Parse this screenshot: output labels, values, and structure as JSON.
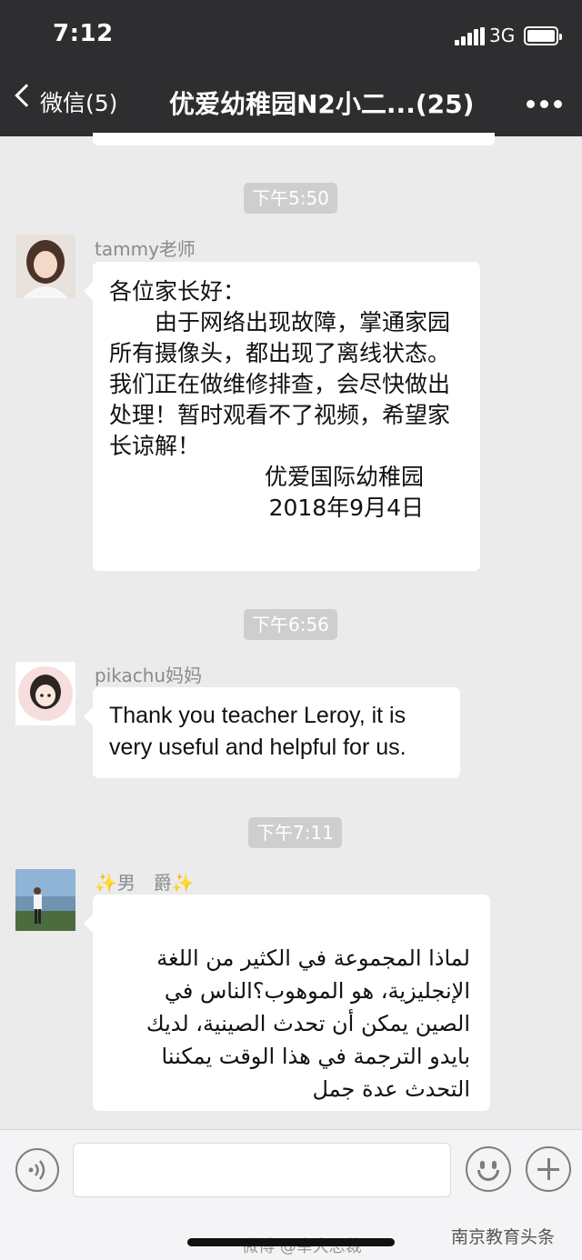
{
  "status_bar": {
    "time": "7:12",
    "network": "3G"
  },
  "nav": {
    "back_label": "微信(5)",
    "title": "优爱幼稚园N2小二...(25)"
  },
  "messages": [
    {
      "time": "下午5:50",
      "sender": "tammy老师",
      "lines": [
        "各位家长好：",
        "由于网络出现故障，掌通家园所有摄像头，都出现了离线状态。我们正在做维修排查，会尽快做出处理！暂时观看不了视频，希望家长谅解！",
        "优爱国际幼稚园",
        "2018年9月4日"
      ]
    },
    {
      "time": "下午6:56",
      "sender": "pikachu妈妈",
      "text": "Thank you teacher Leroy, it is very useful and helpful for us."
    },
    {
      "time": "下午7:11",
      "sender": "✨男　爵✨",
      "text": "لماذا المجموعة في الكثير من اللغة الإنجليزية، هو الموهوب؟الناس في الصين يمكن أن تحدث الصينية، لديك بايدو الترجمة في هذا الوقت يمكننا التحدث عدة جمل"
    }
  ],
  "watermarks": {
    "left": "微博 @幸大总裁",
    "right": "南京教育头条"
  }
}
